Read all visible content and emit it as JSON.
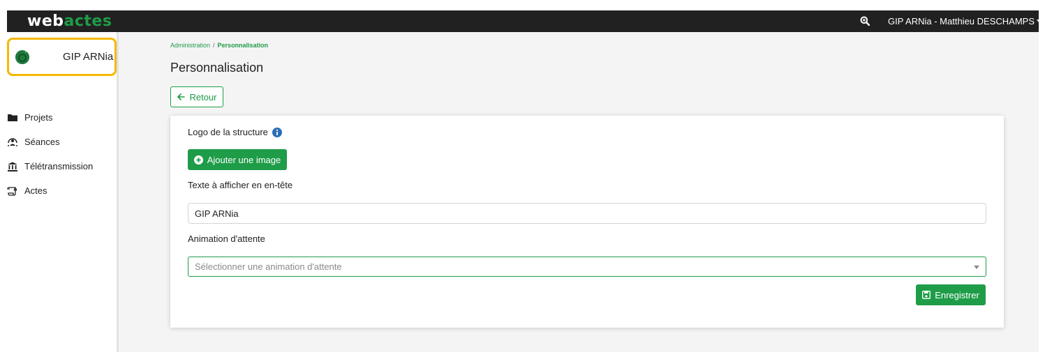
{
  "app": {
    "logo_part1": "web",
    "logo_part2": "actes",
    "brand_color": "#1e9c48"
  },
  "topbar": {
    "search_icon": "search-zoom-icon",
    "user_label": "GIP ARNia - Matthieu DESCHAMPS"
  },
  "sidebar": {
    "org_name": "GIP ARNia",
    "highlight_color": "#f5b800",
    "items": [
      {
        "label": "Projets",
        "icon": "folder-icon"
      },
      {
        "label": "Séances",
        "icon": "meeting-icon"
      },
      {
        "label": "Télétransmission",
        "icon": "institution-icon"
      },
      {
        "label": "Actes",
        "icon": "scroll-icon"
      }
    ]
  },
  "breadcrumb": {
    "parent": "Administration",
    "separator": "/",
    "current": "Personnalisation"
  },
  "page": {
    "title": "Personnalisation",
    "back_label": "Retour"
  },
  "form": {
    "logo_label": "Logo de la structure",
    "add_image_label": "Ajouter une image",
    "header_text_label": "Texte à afficher en en-tête",
    "header_text_value": "GIP ARNia",
    "animation_label": "Animation d'attente",
    "animation_placeholder": "Sélectionner une animation d'attente",
    "save_label": "Enregistrer"
  }
}
